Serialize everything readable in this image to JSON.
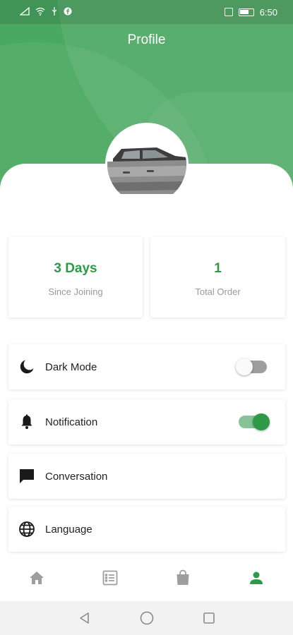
{
  "status_bar": {
    "time": "6:50",
    "left_icons": [
      "sim-icon",
      "wifi-icon",
      "usb-icon",
      "facebook-icon"
    ],
    "right_icons": [
      "vibrate-icon",
      "battery-icon"
    ]
  },
  "header": {
    "title": "Profile",
    "color": "#4aa961"
  },
  "avatar": {
    "image": "car-photo"
  },
  "stats": [
    {
      "value": "3 Days",
      "label": "Since Joining"
    },
    {
      "value": "1",
      "label": "Total Order"
    }
  ],
  "settings": [
    {
      "label": "Dark Mode",
      "icon": "moon-icon",
      "toggle": "off"
    },
    {
      "label": "Notification",
      "icon": "bell-icon",
      "toggle": "on"
    },
    {
      "label": "Conversation",
      "icon": "chat-icon"
    },
    {
      "label": "Language",
      "icon": "globe-icon"
    }
  ],
  "bottom_nav": [
    {
      "icon": "home-icon",
      "active": false
    },
    {
      "icon": "orders-list-icon",
      "active": false
    },
    {
      "icon": "bag-icon",
      "active": false
    },
    {
      "icon": "profile-icon",
      "active": true
    }
  ],
  "colors": {
    "accent": "#2e9a47",
    "inactive": "#9e9e9e"
  }
}
